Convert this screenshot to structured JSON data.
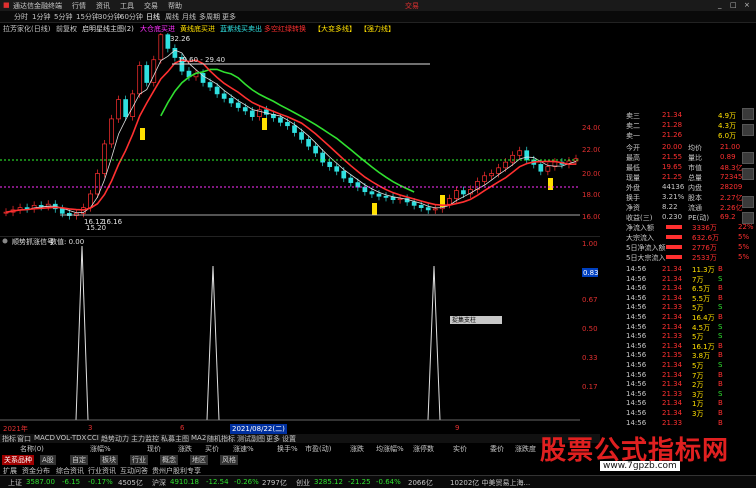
{
  "window": {
    "title": "通达信金融终端",
    "menu": [
      "行情",
      "资讯",
      "工具",
      "交易",
      "帮助"
    ],
    "right_label": "交易"
  },
  "toolbar": {
    "items": [
      "分时",
      "1分钟",
      "5分钟",
      "15分钟",
      "30分钟",
      "60分钟",
      "日线",
      "周线",
      "月线",
      "多周期",
      "更多"
    ],
    "active": "日线"
  },
  "indicators_bar": {
    "stock": "拉芳家化(日线)",
    "mode": "前复权",
    "items": [
      "启明星线主图(2)",
      "大仓底买进",
      "黄线底买进",
      "蓝紫线买卖出",
      "多空红绿转换",
      "【大变多线】",
      "【强力线】"
    ]
  },
  "main_chart": {
    "high_label": "32.26",
    "low_label": "16.12",
    "range_label": "19.60 - 29.40",
    "low_sub_label": "16.16",
    "low_sub_label2": "15.20",
    "y_ticks": [
      "24.00",
      "22.00",
      "20.00",
      "18.00",
      "16.00"
    ],
    "colors": {
      "up": "#ff3030",
      "down": "#30e0e0",
      "ma_white": "#e0e0e0",
      "ma_green": "#30e030",
      "ma_red": "#ff3030",
      "guide_green": "#30ff30",
      "guide_purple": "#ff30ff",
      "signal_yellow": "#ffe000"
    }
  },
  "sub_chart": {
    "title": "顺势抓涨信号",
    "value_label": "数值: 0.00",
    "y_ticks": [
      "1.00",
      "0.83",
      "0.67",
      "0.50",
      "0.33",
      "0.17"
    ],
    "value_box": "0.83",
    "tooltip": "捉集支柱"
  },
  "date_axis": {
    "labels": [
      "2021年",
      "3",
      "6",
      "2021/08/22(二)",
      "9"
    ]
  },
  "bottom_tabs": [
    "指标",
    "窗口",
    "MACD",
    "VOL-TDX",
    "CCI",
    "趋势动力",
    "主力监控",
    "私募主图",
    "MA2",
    "随机指标",
    "测试副图",
    "更多",
    "设置"
  ],
  "bottom_cols": [
    "名称(0)",
    "涨幅%",
    "现价",
    "涨跌",
    "买价",
    "卖价",
    "总量",
    "现量",
    "涨速%",
    "换手%",
    "市盈(动)",
    "涨跌",
    "均涨幅%",
    "涨停数",
    "实价",
    "委价",
    "涨跌度"
  ],
  "bottom_row2": [
    "关系品种",
    "A股",
    "自定",
    "板块",
    "行业",
    "概念",
    "地区",
    "风格",
    "指数",
    "基金",
    "债券",
    "期货",
    "外汇"
  ],
  "bottom_row3": [
    "扩展",
    "资金分布",
    "综合资讯",
    "行业资讯",
    "互动问答",
    "贵州户股利专享"
  ],
  "quote_panel": {
    "rows": [
      {
        "l1": "卖三",
        "v1": "21.34",
        "v2": "4.9万"
      },
      {
        "l1": "卖二",
        "v1": "21.28",
        "v2": "4.3万"
      },
      {
        "l1": "卖一",
        "v1": "21.26",
        "v2": "6.0万"
      },
      {
        "l1": "今开",
        "v1": "20.00",
        "l2": "均价",
        "v3": "21.00"
      },
      {
        "l1": "最高",
        "v1": "21.55",
        "l2": "量比",
        "v3": "0.89"
      },
      {
        "l1": "最低",
        "v1": "19.65",
        "l2": "市值",
        "v3": "48.3亿"
      },
      {
        "l1": "现量",
        "v1": "21.25",
        "l2": "总量",
        "v3": "72345"
      },
      {
        "l1": "外盘",
        "v1": "44136",
        "l2": "内盘",
        "v3": "28209"
      },
      {
        "l1": "换手",
        "v1": "3.21%",
        "l2": "股本",
        "v3": "2.27亿"
      },
      {
        "l1": "净资",
        "v1": "8.22",
        "l2": "流通",
        "v3": "2.26亿"
      },
      {
        "l1": "收益(三)",
        "v1": "0.230",
        "l2": "PE(动)",
        "v3": "69.2"
      }
    ],
    "flows": [
      {
        "label": "净流入额",
        "value": "3336万",
        "pct": "22%"
      },
      {
        "label": "大宗流入",
        "value": "632.6万",
        "pct": "5%"
      },
      {
        "label": "5日净流入额",
        "value": "2776万",
        "pct": "5%"
      },
      {
        "label": "5日大宗流入",
        "value": "2533万",
        "pct": "5%"
      }
    ],
    "ticks": [
      {
        "t": "14:56",
        "p": "21.34",
        "v": "11.3",
        "f": "万",
        "s": "B"
      },
      {
        "t": "14:56",
        "p": "21.34",
        "v": "7",
        "f": "万",
        "s": "S"
      },
      {
        "t": "14:56",
        "p": "21.34",
        "v": "6.5",
        "f": "万",
        "s": "B"
      },
      {
        "t": "14:56",
        "p": "21.34",
        "v": "5.5",
        "f": "万",
        "s": "B"
      },
      {
        "t": "14:56",
        "p": "21.33",
        "v": "5",
        "f": "万",
        "s": "S"
      },
      {
        "t": "14:56",
        "p": "21.34",
        "v": "16.4",
        "f": "万",
        "s": "B"
      },
      {
        "t": "14:56",
        "p": "21.34",
        "v": "4.5",
        "f": "万",
        "s": "S"
      },
      {
        "t": "14:56",
        "p": "21.33",
        "v": "5",
        "f": "万",
        "s": "S"
      },
      {
        "t": "14:56",
        "p": "21.34",
        "v": "16.1",
        "f": "万",
        "s": "B"
      },
      {
        "t": "14:56",
        "p": "21.35",
        "v": "3.8",
        "f": "万",
        "s": "B"
      },
      {
        "t": "14:56",
        "p": "21.34",
        "v": "5",
        "f": "万",
        "s": "S"
      },
      {
        "t": "14:56",
        "p": "21.34",
        "v": "7",
        "f": "万",
        "s": "B"
      },
      {
        "t": "14:56",
        "p": "21.34",
        "v": "2",
        "f": "万",
        "s": "B"
      },
      {
        "t": "14:56",
        "p": "21.33",
        "v": "3",
        "f": "万",
        "s": "S"
      },
      {
        "t": "14:56",
        "p": "21.34",
        "v": "1",
        "f": "万",
        "s": "B"
      },
      {
        "t": "14:56",
        "p": "21.34",
        "v": "3",
        "f": "万",
        "s": "B"
      },
      {
        "t": "14:56",
        "p": "21.33",
        "v": "",
        "f": "",
        "s": "B"
      }
    ]
  },
  "index_strip": [
    {
      "name": "上证",
      "val": "3587.00",
      "chg": "-6.15",
      "pct": "-0.17%",
      "amt": "4505亿"
    },
    {
      "name": "沪深",
      "val": "4910.18",
      "chg": "-12.54",
      "pct": "-0.26%",
      "amt": "2797亿"
    },
    {
      "name": "创业",
      "val": "3285.12",
      "chg": "-21.25",
      "pct": "-0.64%",
      "amt": "2066亿"
    }
  ],
  "index_strip_extra": "10202亿 中美贸易上海...",
  "watermark": {
    "text": "股票公式指标网",
    "url": "www.7gpzb.com"
  }
}
